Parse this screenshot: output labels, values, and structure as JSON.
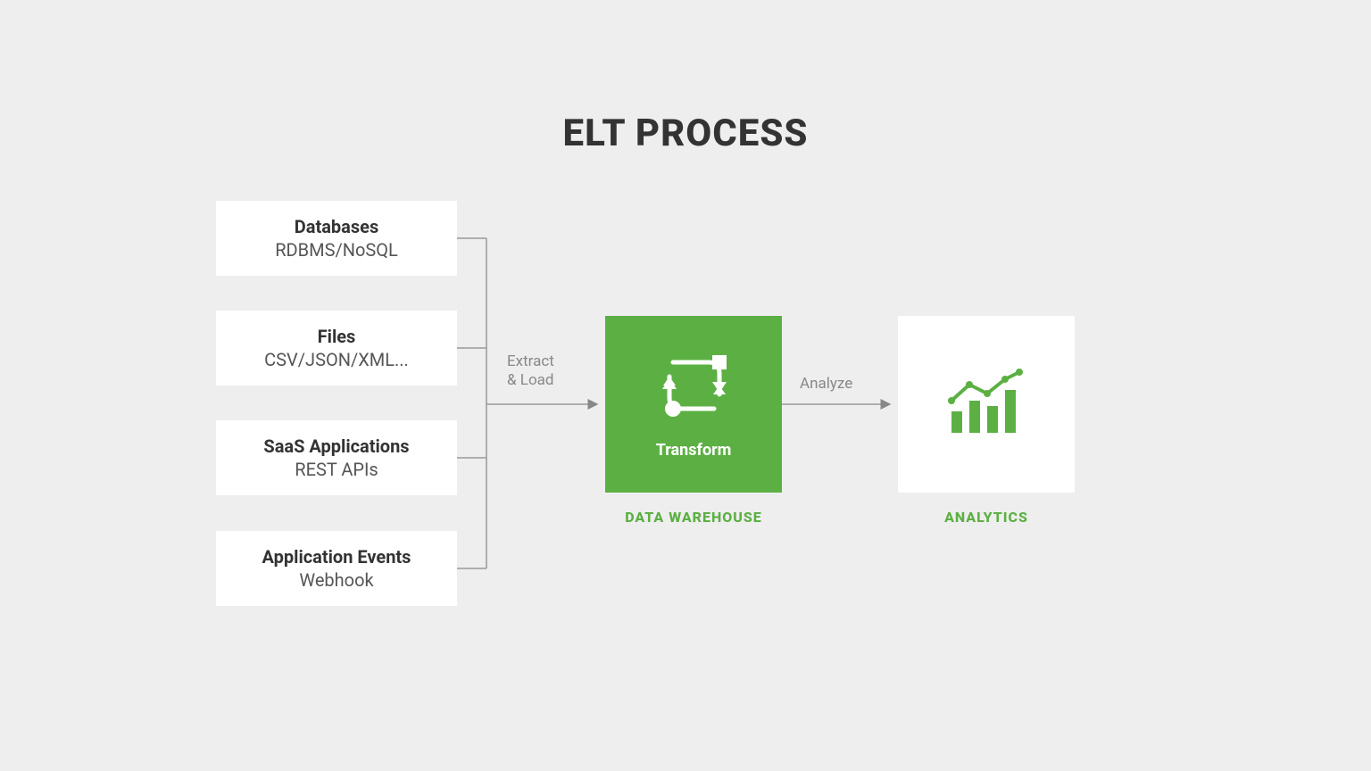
{
  "title": "ELT PROCESS",
  "sources": [
    {
      "heading": "Databases",
      "sub": "RDBMS/NoSQL"
    },
    {
      "heading": "Files",
      "sub": "CSV/JSON/XML..."
    },
    {
      "heading": "SaaS Applications",
      "sub": "REST APIs"
    },
    {
      "heading": "Application Events",
      "sub": "Webhook"
    }
  ],
  "edges": {
    "extract_load": "Extract\n& Load",
    "analyze": "Analyze"
  },
  "warehouse": {
    "transform_label": "Transform",
    "caption": "DATA WAREHOUSE"
  },
  "analytics": {
    "caption": "ANALYTICS"
  },
  "colors": {
    "accent": "#5CB043",
    "bg": "#eeeeee",
    "card": "#ffffff",
    "text_dark": "#333333",
    "text_muted": "#888888"
  }
}
